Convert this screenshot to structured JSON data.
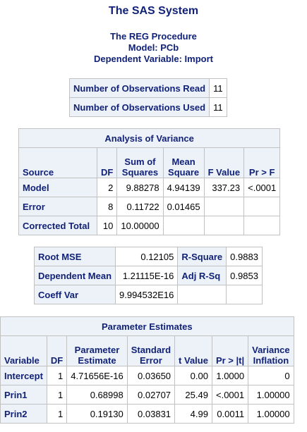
{
  "header": {
    "title": "The SAS System",
    "procedure": "The REG Procedure",
    "model": "Model: PCb",
    "dependent": "Dependent Variable: Import"
  },
  "observations": [
    {
      "label": "Number of Observations Read",
      "value": "11"
    },
    {
      "label": "Number of Observations Used",
      "value": "11"
    }
  ],
  "anova": {
    "caption": "Analysis of Variance",
    "headers": {
      "source": "Source",
      "df": "DF",
      "ss_line1": "Sum of",
      "ss_line2": "Squares",
      "ms_line1": "Mean",
      "ms_line2": "Square",
      "fvalue": "F Value",
      "prf": "Pr > F"
    },
    "rows": [
      {
        "source": "Model",
        "df": "2",
        "ss": "9.88278",
        "ms": "4.94139",
        "f": "337.23",
        "p": "<.0001"
      },
      {
        "source": "Error",
        "df": "8",
        "ss": "0.11722",
        "ms": "0.01465",
        "f": "",
        "p": ""
      },
      {
        "source": "Corrected Total",
        "df": "10",
        "ss": "10.00000",
        "ms": "",
        "f": "",
        "p": ""
      }
    ]
  },
  "fit": {
    "rows": [
      {
        "l1": "Root MSE",
        "v1": "0.12105",
        "l2": "R-Square",
        "v2": "0.9883"
      },
      {
        "l1": "Dependent Mean",
        "v1": "1.21115E-16",
        "l2": "Adj R-Sq",
        "v2": "0.9853"
      },
      {
        "l1": "Coeff Var",
        "v1": "9.994532E16",
        "l2": "",
        "v2": ""
      }
    ]
  },
  "params": {
    "caption": "Parameter Estimates",
    "headers": {
      "variable": "Variable",
      "df": "DF",
      "pe_line1": "Parameter",
      "pe_line2": "Estimate",
      "se_line1": "Standard",
      "se_line2": "Error",
      "t": "t Value",
      "p": "Pr > |t|",
      "vi_line1": "Variance",
      "vi_line2": "Inflation"
    },
    "rows": [
      {
        "var": "Intercept",
        "df": "1",
        "est": "4.71656E-16",
        "se": "0.03650",
        "t": "0.00",
        "p": "1.0000",
        "vif": "0"
      },
      {
        "var": "Prin1",
        "df": "1",
        "est": "0.68998",
        "se": "0.02707",
        "t": "25.49",
        "p": "<.0001",
        "vif": "1.00000"
      },
      {
        "var": "Prin2",
        "df": "1",
        "est": "0.19130",
        "se": "0.03831",
        "t": "4.99",
        "p": "0.0011",
        "vif": "1.00000"
      }
    ]
  }
}
